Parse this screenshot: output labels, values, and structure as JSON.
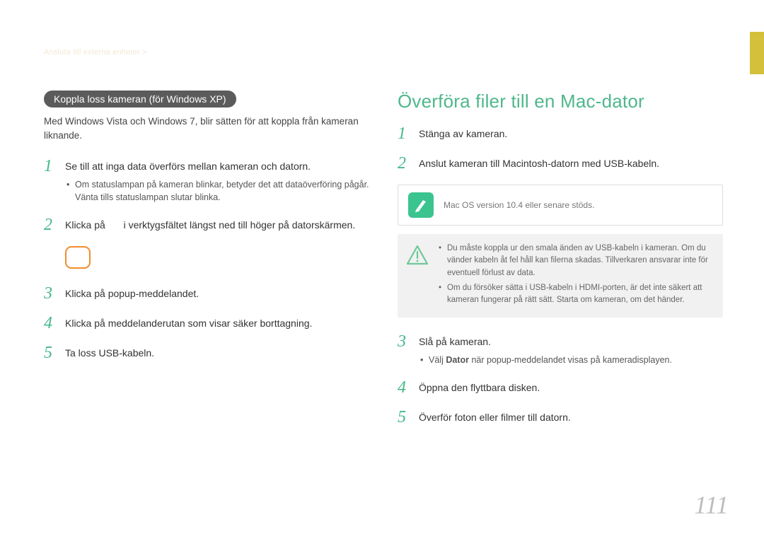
{
  "breadcrumb": "Ansluta till externa enheter >",
  "left": {
    "pill": "Koppla loss kameran (för Windows XP)",
    "intro": "Med Windows Vista och Windows 7, blir sätten för att koppla från kameran liknande.",
    "steps": [
      {
        "n": "1",
        "text": "Se till att inga data överförs mellan kameran och datorn.",
        "sub": "Om statuslampan på kameran blinkar, betyder det att dataöverföring pågår. Vänta tills statuslampan slutar blinka."
      },
      {
        "n": "2",
        "text_a": "Klicka på ",
        "text_b": " i verktygsfältet längst ned till höger på datorskärmen."
      },
      {
        "n": "3",
        "text": "Klicka på popup-meddelandet."
      },
      {
        "n": "4",
        "text": "Klicka på meddelanderutan som visar säker borttagning."
      },
      {
        "n": "5",
        "text": "Ta loss USB-kabeln."
      }
    ]
  },
  "right": {
    "title": "Överföra filer till en Mac-dator",
    "steps_a": [
      {
        "n": "1",
        "text": "Stänga av kameran."
      },
      {
        "n": "2",
        "text": "Anslut kameran till Macintosh-datorn med USB-kabeln."
      }
    ],
    "note": "Mac OS version 10.4 eller senare stöds.",
    "warn": [
      "Du måste koppla ur den smala änden av USB-kabeln i kameran. Om du vänder kabeln åt fel håll kan filerna skadas. Tillverkaren ansvarar inte för eventuell förlust av data.",
      "Om du försöker sätta i USB-kabeln i HDMI-porten, är det inte säkert att kameran fungerar på rätt sätt. Starta om kameran, om det händer."
    ],
    "steps_b": [
      {
        "n": "3",
        "text": "Slå på kameran.",
        "sub_pre": "Välj ",
        "sub_bold": "Dator",
        "sub_post": " när popup-meddelandet visas på kameradisplayen."
      },
      {
        "n": "4",
        "text": "Öppna den flyttbara disken."
      },
      {
        "n": "5",
        "text": "Överför foton eller filmer till datorn."
      }
    ]
  },
  "page_number": "111"
}
